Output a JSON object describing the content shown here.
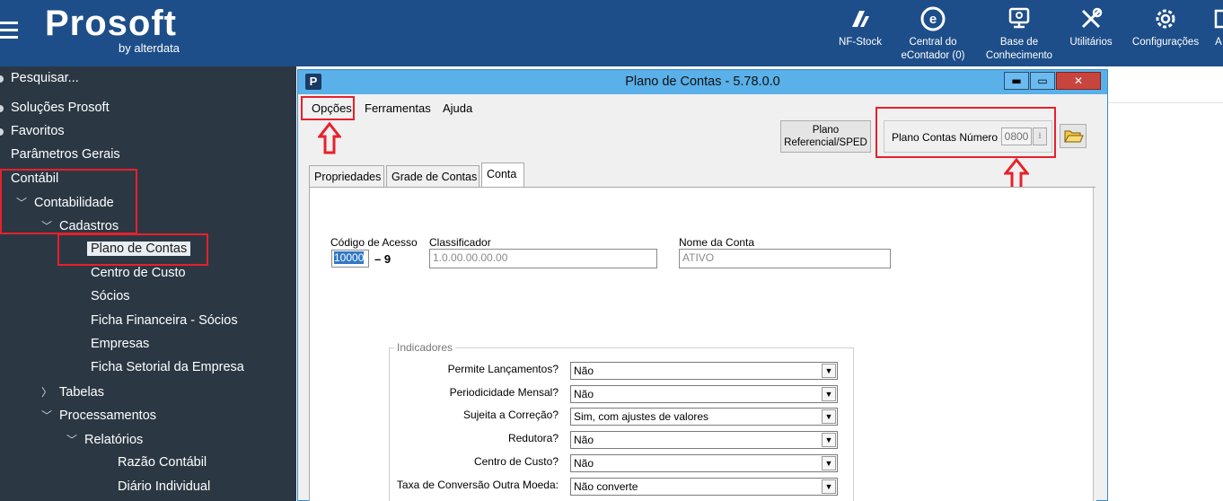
{
  "header": {
    "brand": "Prosoft",
    "byline": "by alterdata",
    "tools": [
      {
        "icon": "nf-stock-icon",
        "label": "NF-Stock"
      },
      {
        "icon": "econtador-icon",
        "label": "Central do",
        "label2": "eContador (0)"
      },
      {
        "icon": "knowledge-base-icon",
        "label": "Base de",
        "label2": "Conhecimento"
      },
      {
        "icon": "utilities-icon",
        "label": "Utilitários"
      },
      {
        "icon": "gear-icon",
        "label": "Configurações"
      },
      {
        "icon": "truncated-icon",
        "label": "A"
      }
    ]
  },
  "sidebar": {
    "items": [
      {
        "label": "Pesquisar..."
      },
      {
        "label": "Soluções Prosoft"
      },
      {
        "label": "Favoritos"
      },
      {
        "label": "Parâmetros Gerais"
      },
      {
        "label": "Contábil"
      },
      {
        "label": "Contabilidade"
      },
      {
        "label": "Cadastros"
      },
      {
        "label": "Plano de Contas"
      },
      {
        "label": "Centro de Custo"
      },
      {
        "label": "Sócios"
      },
      {
        "label": "Ficha Financeira - Sócios"
      },
      {
        "label": "Empresas"
      },
      {
        "label": "Ficha Setorial da Empresa"
      },
      {
        "label": "Tabelas"
      },
      {
        "label": "Processamentos"
      },
      {
        "label": "Relatórios"
      },
      {
        "label": "Razão Contábil"
      },
      {
        "label": "Diário Individual"
      }
    ]
  },
  "window": {
    "app_icon": "P",
    "title": "Plano de Contas - 5.78.0.0",
    "controls": {
      "minimize": "▬",
      "maximize": "▭",
      "close": "✕"
    },
    "menu": [
      "Opções",
      "Ferramentas",
      "Ajuda"
    ],
    "ref_button": {
      "line1": "Plano",
      "line2": "Referencial/SPED"
    },
    "plano_numero": {
      "label": "Plano Contas Número",
      "value": "0800"
    },
    "tabs": [
      "Propriedades",
      "Grade de Contas",
      "Conta"
    ],
    "active_tab": "Conta",
    "fields": {
      "codigo_label": "Código de Acesso",
      "codigo_value": "10000",
      "codigo_digit": "– 9",
      "classificador_label": "Classificador",
      "classificador_value": "1.0.00.00.00.00",
      "nome_label": "Nome da Conta",
      "nome_value": "ATIVO"
    },
    "indicadores": {
      "title": "Indicadores",
      "rows": [
        {
          "label": "Permite Lançamentos?",
          "value": "Não"
        },
        {
          "label": "Periodicidade Mensal?",
          "value": "Não"
        },
        {
          "label": "Sujeita a Correção?",
          "value": "Sim, com ajustes de valores"
        },
        {
          "label": "Redutora?",
          "value": "Não"
        },
        {
          "label": "Centro de Custo?",
          "value": "Não"
        },
        {
          "label": "Taxa de Conversão Outra Moeda:",
          "value": "Não converte"
        }
      ]
    }
  },
  "colors": {
    "header_bg": "#1d4e89",
    "sidebar_bg": "#2b3844",
    "highlight_red": "#e8202a",
    "titlebar_bg": "#5ab0e8"
  }
}
